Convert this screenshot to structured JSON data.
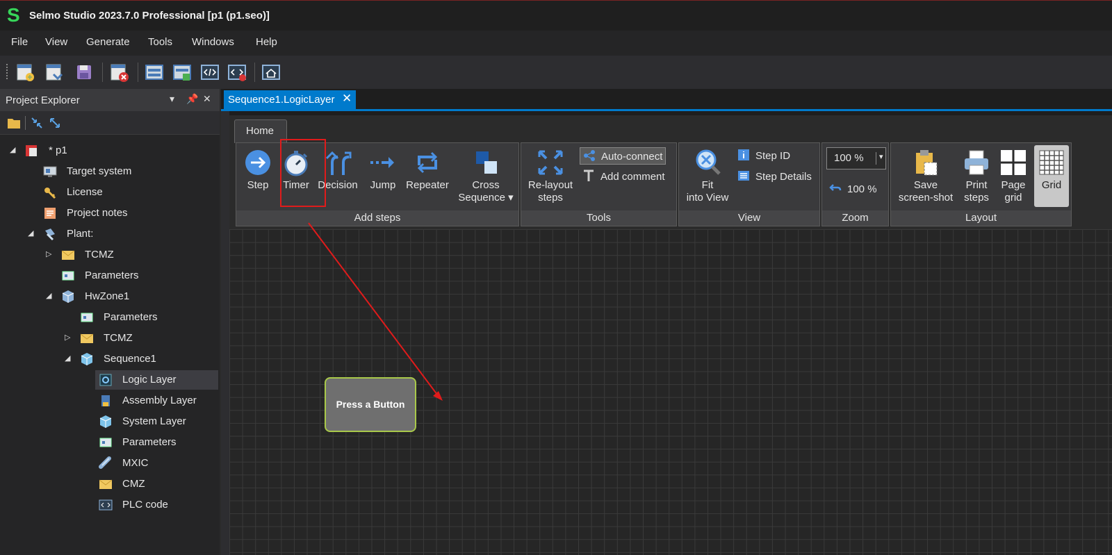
{
  "window": {
    "logo": "S",
    "title": "Selmo Studio 2023.7.0 Professional  [p1 (p1.seo)]"
  },
  "menu": [
    "File",
    "View",
    "Generate",
    "Tools",
    "Windows",
    "Help"
  ],
  "toolbar": [
    "new-project-icon",
    "open-icon",
    "save-icon",
    "close-project-icon",
    "layout-icon",
    "layout-green-icon",
    "code-icon",
    "code-remove-icon",
    "home-icon"
  ],
  "explorer": {
    "title": "Project Explorer",
    "tree": [
      {
        "label": "* p1",
        "expanded": true
      },
      {
        "label": "Target system"
      },
      {
        "label": "License"
      },
      {
        "label": "Project notes"
      },
      {
        "label": "Plant:",
        "expanded": true
      },
      {
        "label": "TCMZ",
        "expanded": false
      },
      {
        "label": "Parameters"
      },
      {
        "label": "HwZone1",
        "expanded": true
      },
      {
        "label": "Parameters"
      },
      {
        "label": "TCMZ",
        "expanded": false
      },
      {
        "label": "Sequence1",
        "expanded": true
      },
      {
        "label": "Logic Layer",
        "selected": true
      },
      {
        "label": "Assembly Layer"
      },
      {
        "label": "System Layer"
      },
      {
        "label": "Parameters"
      },
      {
        "label": "MXIC"
      },
      {
        "label": "CMZ"
      },
      {
        "label": "PLC code"
      }
    ]
  },
  "doc_tab": {
    "label": "Sequence1.LogicLayer",
    "close": "✕"
  },
  "ribbon": {
    "tab": "Home",
    "add_steps": {
      "label": "Add steps",
      "step": "Step",
      "timer": "Timer",
      "decision": "Decision",
      "jump": "Jump",
      "repeater": "Repeater",
      "cross_1": "Cross",
      "cross_2": "Sequence"
    },
    "tools": {
      "label": "Tools",
      "relayout_1": "Re-layout",
      "relayout_2": "steps",
      "auto_connect": "Auto-connect",
      "add_comment": "Add comment"
    },
    "view": {
      "label": "View",
      "fit_1": "Fit",
      "fit_2": "into View",
      "step_id": "Step ID",
      "step_details": "Step Details"
    },
    "zoom": {
      "label": "Zoom",
      "value": "100 %",
      "reset": "100 %"
    },
    "layout": {
      "label": "Layout",
      "save_1": "Save",
      "save_2": "screen-shot",
      "print_1": "Print",
      "print_2": "steps",
      "page_1": "Page",
      "page_2": "grid",
      "grid": "Grid"
    }
  },
  "canvas": {
    "node_label": "Press a Button"
  },
  "colors": {
    "accent": "#007acc",
    "highlight": "#e01b1b",
    "node_border": "#a9c94a",
    "logo": "#37d65a"
  }
}
